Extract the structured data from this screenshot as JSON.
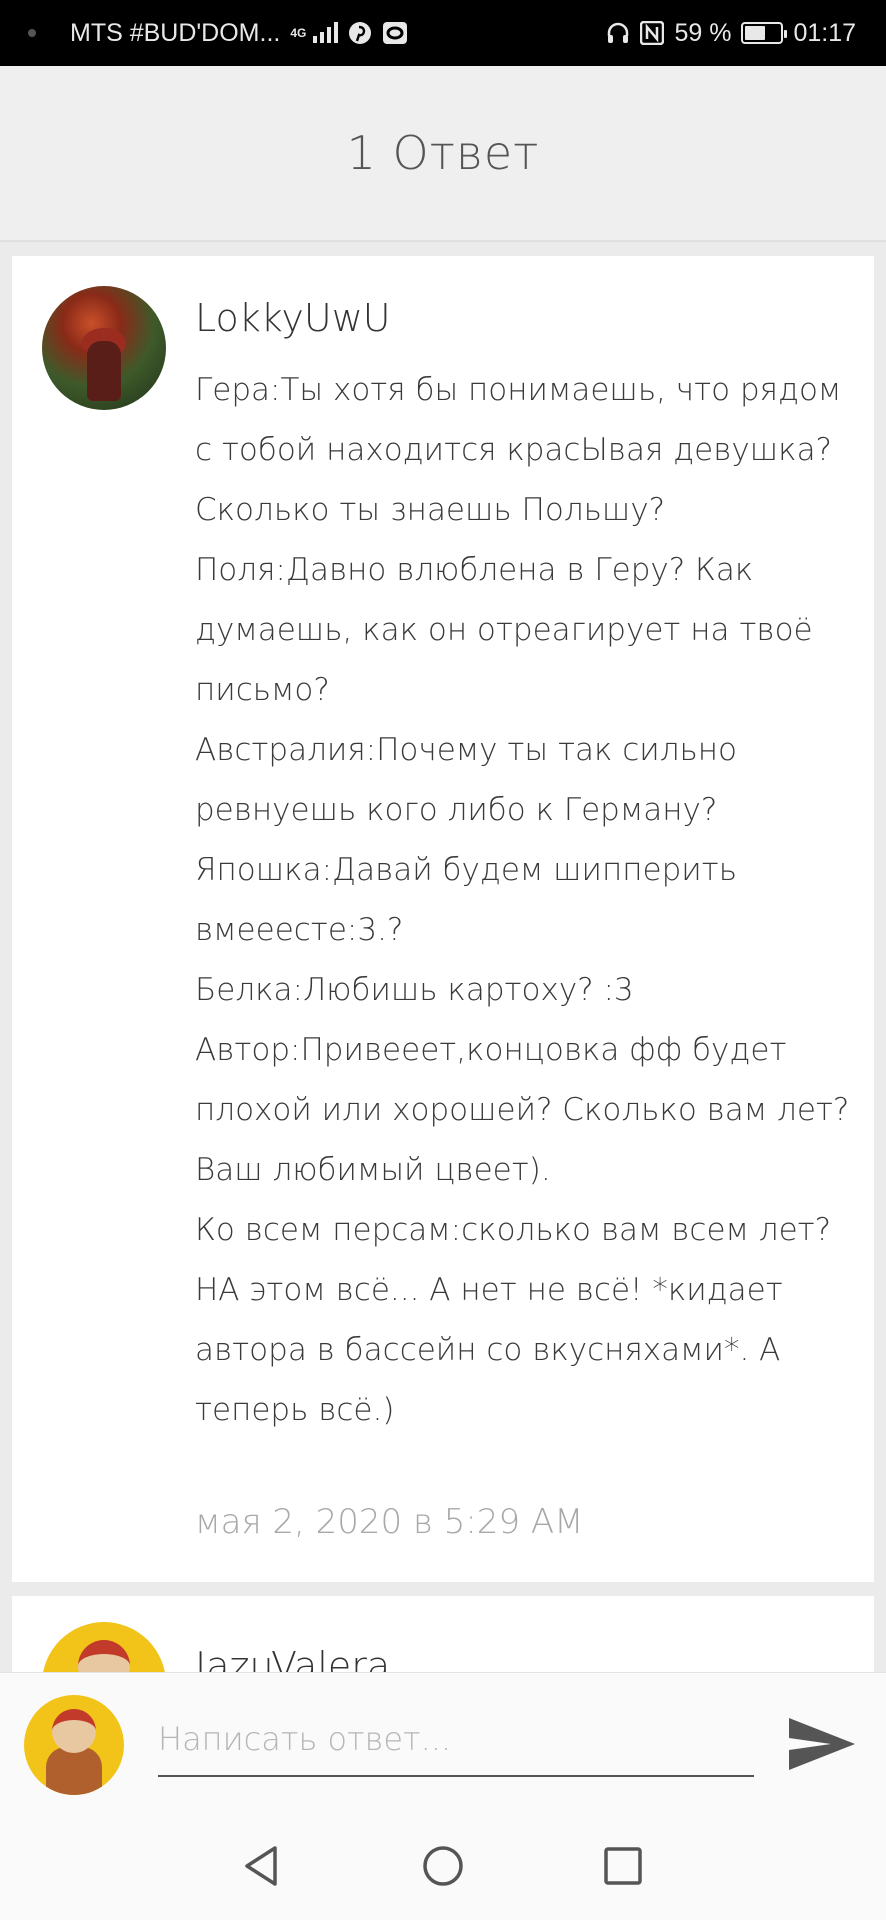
{
  "status_bar": {
    "carrier": "MTS #BUD'DOM...",
    "network": "4G",
    "battery_percent_text": "59 %",
    "battery_level": 0.59,
    "time": "01:17",
    "icons": [
      "signal-icon",
      "pinterest-icon",
      "app-icon",
      "headphones-icon",
      "nfc-icon",
      "battery-icon"
    ]
  },
  "header": {
    "title": "1 Ответ"
  },
  "comments": [
    {
      "author": "LokkyUwU",
      "text": "Гера:Ты хотя бы понимаешь, что рядом с тобой находится красЫвая девушка?Сколько ты знаешь Польшу?\nПоля:Давно влюблена в Геру? Как думаешь, как он отреагирует на твоё письмо?\nАвстралия:Почему ты так сильно ревнуешь кого либо к Герману?\nЯпошка:Давай будем шипперить вмееесте:3.?\nБелка:Любишь картоху? :3\nАвтор:Привееет,концовка фф будет плохой или хорошей? Сколько вам лет? Ваш любимый цвеет).\nКо всем персам:сколько вам всем лет?\nНА этом всё... А нет не всё! *кидает автора в бассейн со вкусняхами*. А теперь всё.)",
      "timestamp": "мая 2, 2020 в 5:29 AM"
    },
    {
      "author": "JazuValera"
    }
  ],
  "reply": {
    "placeholder": "Написать ответ...",
    "value": ""
  },
  "colors": {
    "status_bar_bg": "#000000",
    "header_bg": "#efefef",
    "page_bg": "#ebebeb",
    "card_bg": "#ffffff",
    "text": "#3a3a3a",
    "muted": "#a8a8a8",
    "send_icon": "#555555"
  }
}
